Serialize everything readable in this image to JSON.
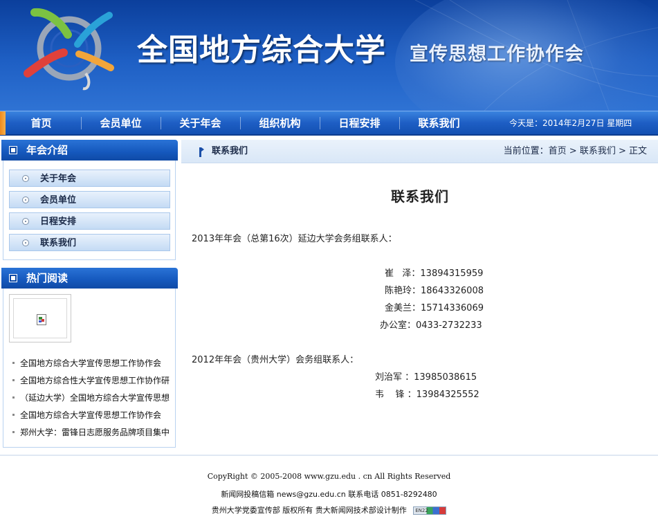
{
  "header": {
    "title": "全国地方综合大学",
    "subtitle": "宣传思想工作协作会"
  },
  "nav": {
    "items": [
      "首页",
      "会员单位",
      "关于年会",
      "组织机构",
      "日程安排",
      "联系我们"
    ],
    "date_text": "今天是：2014年2月27日  星期四"
  },
  "sidebar": {
    "intro": {
      "title": "年会介绍",
      "items": [
        "关于年会",
        "会员单位",
        "日程安排",
        "联系我们"
      ]
    },
    "hot": {
      "title": "热门阅读",
      "items": [
        "全国地方综合大学宣传思想工作协作会",
        "全国地方综合性大学宣传思想工作协作研",
        "（延边大学）全国地方综合大学宣传思想",
        "全国地方综合大学宣传思想工作协作会",
        "郑州大学：雷锋日志愿服务品牌项目集中"
      ]
    }
  },
  "breadcrumb": {
    "section": "联系我们",
    "path": "当前位置：首页 > 联系我们 > 正文"
  },
  "article": {
    "title": "联系我们",
    "para_2013": "2013年年会（总第16次）延边大学会务组联系人：",
    "contacts_2013": [
      "崔   泽：13894315959",
      "陈艳玲：18643326008",
      "金美兰：15714336069",
      "办公室：0433-2732233"
    ],
    "para_2012": "2012年年会（贵州大学）会务组联系人：",
    "contacts_2012": [
      "刘治军 ：13985038615",
      "韦    锋 ：13984325552"
    ]
  },
  "footer": {
    "copyright": "CopyRight © 2005-2008 www.gzu.edu . cn All Rights Reserved",
    "contact": "新闻网投稿信箱 news@gzu.edu.cn 联系电话 0851-8292480",
    "credits": "贵州大学党委宣传部   版权所有 贵大新闻网技术部设计制作",
    "badge": "EN22"
  }
}
